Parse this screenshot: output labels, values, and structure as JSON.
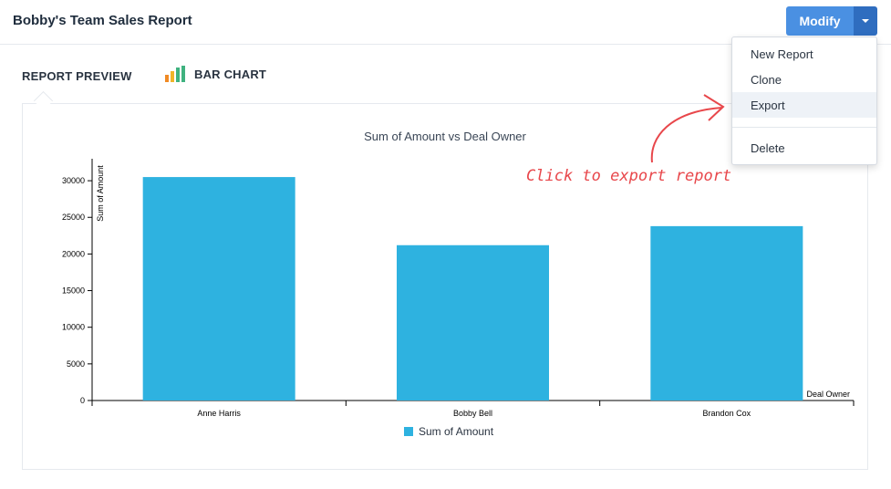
{
  "header": {
    "title": "Bobby's Team Sales Report",
    "modify_label": "Modify"
  },
  "tabs": {
    "preview_label": "REPORT PREVIEW",
    "chart_label": "BAR CHART"
  },
  "menu": {
    "items": [
      "New Report",
      "Clone",
      "Export",
      "Delete"
    ],
    "highlighted": "Export"
  },
  "annotation": {
    "text": "Click to export report"
  },
  "colors": {
    "primary": "#4a90e2",
    "primary_dark": "#2f6dbf",
    "bar": "#2eb2e0",
    "annotation": "#e8474b"
  },
  "chart_data": {
    "type": "bar",
    "title": "Sum of Amount vs Deal Owner",
    "xlabel": "Deal Owner",
    "ylabel": "Sum of Amount",
    "categories": [
      "Anne Harris",
      "Bobby Bell",
      "Brandon Cox"
    ],
    "series": [
      {
        "name": "Sum of Amount",
        "values": [
          30500,
          21200,
          23800
        ]
      }
    ],
    "y_ticks": [
      0,
      5000,
      10000,
      15000,
      20000,
      25000,
      30000
    ],
    "ylim": [
      0,
      33000
    ],
    "grid": false,
    "legend": "bottom"
  }
}
